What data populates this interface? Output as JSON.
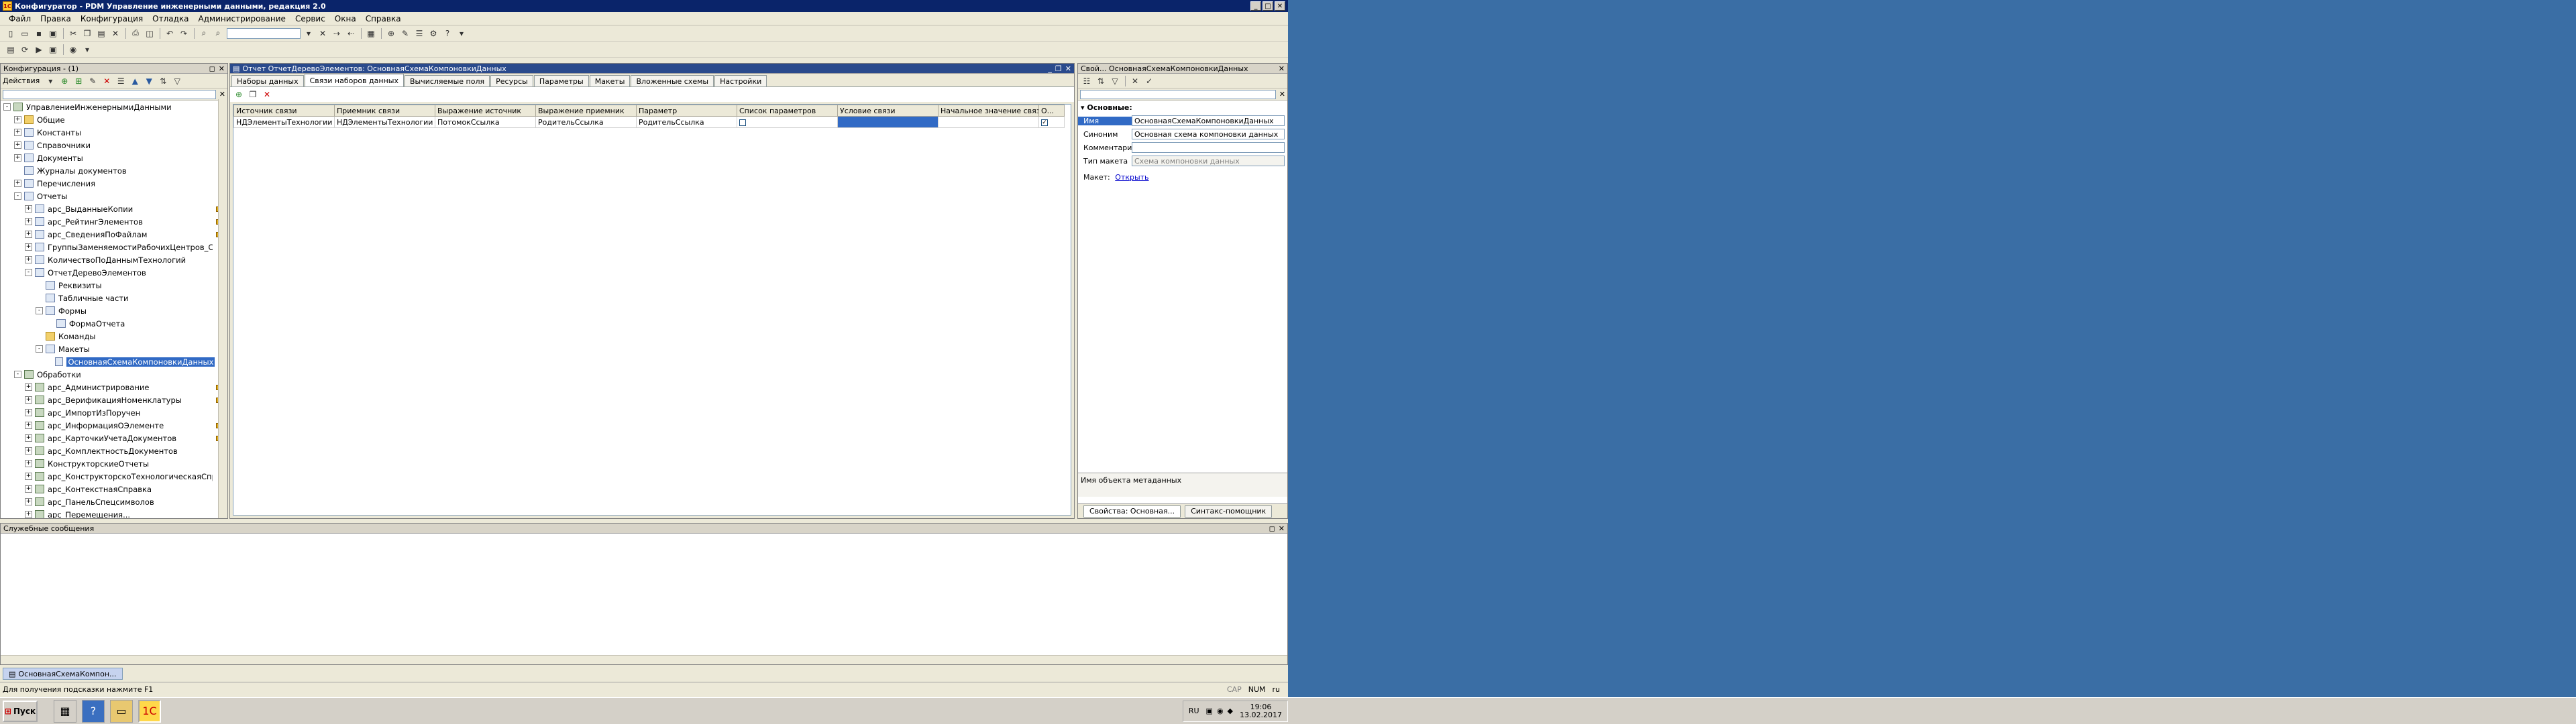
{
  "window": {
    "title": "Конфигуратор - PDM Управление инженерными данными, редакция 2.0"
  },
  "menu": [
    "Файл",
    "Правка",
    "Конфигурация",
    "Отладка",
    "Администрирование",
    "Сервис",
    "Окна",
    "Справка"
  ],
  "config_panel": {
    "title": "Конфигурация - (1)",
    "actions_label": "Действия",
    "tree": [
      {
        "label": "УправлениеИнженернымиДанными",
        "level": 0,
        "exp": "-",
        "icon": "gear",
        "sel": false,
        "marks": 1
      },
      {
        "label": "Общие",
        "level": 1,
        "exp": "+",
        "icon": "folder",
        "sel": false,
        "marks": 0
      },
      {
        "label": "Константы",
        "level": 1,
        "exp": "+",
        "icon": "doc",
        "sel": false,
        "marks": 0
      },
      {
        "label": "Справочники",
        "level": 1,
        "exp": "+",
        "icon": "doc",
        "sel": false,
        "marks": 0
      },
      {
        "label": "Документы",
        "level": 1,
        "exp": "+",
        "icon": "doc",
        "sel": false,
        "marks": 0
      },
      {
        "label": "Журналы документов",
        "level": 1,
        "exp": "",
        "icon": "doc",
        "sel": false,
        "marks": 0
      },
      {
        "label": "Перечисления",
        "level": 1,
        "exp": "+",
        "icon": "doc",
        "sel": false,
        "marks": 0
      },
      {
        "label": "Отчеты",
        "level": 1,
        "exp": "-",
        "icon": "doc",
        "sel": false,
        "marks": 0
      },
      {
        "label": "арс_ВыданныеКопии",
        "level": 2,
        "exp": "+",
        "icon": "doc",
        "sel": false,
        "marks": 2
      },
      {
        "label": "арс_РейтингЭлементов",
        "level": 2,
        "exp": "+",
        "icon": "doc",
        "sel": false,
        "marks": 2
      },
      {
        "label": "арс_СведенияПоФайлам",
        "level": 2,
        "exp": "+",
        "icon": "doc",
        "sel": false,
        "marks": 2
      },
      {
        "label": "ГруппыЗаменяемостиРабочихЦентров_Сп...",
        "level": 2,
        "exp": "+",
        "icon": "doc",
        "sel": false,
        "marks": 0
      },
      {
        "label": "КоличествоПоДаннымТехнологий",
        "level": 2,
        "exp": "+",
        "icon": "doc",
        "sel": false,
        "marks": 0
      },
      {
        "label": "ОтчетДеревоЭлементов",
        "level": 2,
        "exp": "-",
        "icon": "doc",
        "sel": false,
        "marks": 0
      },
      {
        "label": "Реквизиты",
        "level": 3,
        "exp": "",
        "icon": "doc",
        "sel": false,
        "marks": 0
      },
      {
        "label": "Табличные части",
        "level": 3,
        "exp": "",
        "icon": "doc",
        "sel": false,
        "marks": 0
      },
      {
        "label": "Формы",
        "level": 3,
        "exp": "-",
        "icon": "doc",
        "sel": false,
        "marks": 0
      },
      {
        "label": "ФормаОтчета",
        "level": 4,
        "exp": "",
        "icon": "doc",
        "sel": false,
        "marks": 0
      },
      {
        "label": "Команды",
        "level": 3,
        "exp": "",
        "icon": "folder",
        "sel": false,
        "marks": 0
      },
      {
        "label": "Макеты",
        "level": 3,
        "exp": "-",
        "icon": "doc",
        "sel": false,
        "marks": 0
      },
      {
        "label": "ОсновнаяСхемаКомпоновкиДанных",
        "level": 4,
        "exp": "",
        "icon": "doc",
        "sel": true,
        "marks": 0
      },
      {
        "label": "Обработки",
        "level": 1,
        "exp": "-",
        "icon": "gear",
        "sel": false,
        "marks": 0
      },
      {
        "label": "арс_Администрирование",
        "level": 2,
        "exp": "+",
        "icon": "gear",
        "sel": false,
        "marks": 2
      },
      {
        "label": "арс_ВерификацияНоменклатуры",
        "level": 2,
        "exp": "+",
        "icon": "gear",
        "sel": false,
        "marks": 2
      },
      {
        "label": "арс_ИмпортИзПоручен",
        "level": 2,
        "exp": "+",
        "icon": "gear",
        "sel": false,
        "marks": 1
      },
      {
        "label": "арс_ИнформацияОЭлементе",
        "level": 2,
        "exp": "+",
        "icon": "gear",
        "sel": false,
        "marks": 2
      },
      {
        "label": "арс_КарточкиУчетаДокументов",
        "level": 2,
        "exp": "+",
        "icon": "gear",
        "sel": false,
        "marks": 2
      },
      {
        "label": "арс_КомплектностьДокументов",
        "level": 2,
        "exp": "+",
        "icon": "gear",
        "sel": false,
        "marks": 1
      },
      {
        "label": "КонструкторскиеОтчеты",
        "level": 2,
        "exp": "+",
        "icon": "gear",
        "sel": false,
        "marks": 0
      },
      {
        "label": "арс_КонструкторскоТехнологическаяСпра...",
        "level": 2,
        "exp": "+",
        "icon": "gear",
        "sel": false,
        "marks": 0
      },
      {
        "label": "арс_КонтекстнаяСправка",
        "level": 2,
        "exp": "+",
        "icon": "gear",
        "sel": false,
        "marks": 0
      },
      {
        "label": "арс_ПанельСпецсимволов",
        "level": 2,
        "exp": "+",
        "icon": "gear",
        "sel": false,
        "marks": 0
      },
      {
        "label": "арс_Перемещения...",
        "level": 2,
        "exp": "+",
        "icon": "gear",
        "sel": false,
        "marks": 0
      }
    ]
  },
  "editor": {
    "title": "Отчет ОтчетДеревоЭлементов: ОсновнаяСхемаКомпоновкиДанных",
    "tabs": [
      {
        "label": "Наборы данных",
        "active": false
      },
      {
        "label": "Связи наборов данных",
        "active": true
      },
      {
        "label": "Вычисляемые поля",
        "active": false
      },
      {
        "label": "Ресурсы",
        "active": false
      },
      {
        "label": "Параметры",
        "active": false
      },
      {
        "label": "Макеты",
        "active": false
      },
      {
        "label": "Вложенные схемы",
        "active": false
      },
      {
        "label": "Настройки",
        "active": false
      }
    ],
    "columns": [
      "Источник связи",
      "Приемник связи",
      "Выражение источник",
      "Выражение приемник",
      "Параметр",
      "Список параметров",
      "Условие связи",
      "Начальное значение связи",
      "О..."
    ],
    "rows": [
      {
        "source": "НДЭлементыТехнологии",
        "receiver": "НДЭлементыТехнологии",
        "expr_source": "ПотомокСсылка",
        "expr_receiver": "РодительСсылка",
        "param": "РодительСсылка",
        "param_list": false,
        "condition": "",
        "initial": "",
        "o": true
      }
    ]
  },
  "properties": {
    "title": "Свой... ОсновнаяСхемаКомпоновкиДанных",
    "group": "Основные:",
    "fields": [
      {
        "name": "Имя",
        "value": "ОсновнаяСхемаКомпоновкиДанных",
        "sel": true,
        "disabled": false
      },
      {
        "name": "Синоним",
        "value": "Основная схема компоновки данных",
        "sel": false,
        "disabled": false
      },
      {
        "name": "Комментарий",
        "value": "",
        "sel": false,
        "disabled": false
      },
      {
        "name": "Тип макета",
        "value": "Схема компоновки данных",
        "sel": false,
        "disabled": true
      }
    ],
    "maket_label": "Макет:",
    "maket_link": "Открыть",
    "hint": "Имя объекта метаданных",
    "bottom_tabs": [
      "Свойства: Основная...",
      "Синтакс-помощник"
    ]
  },
  "messages": {
    "title": "Служебные сообщения"
  },
  "window_tab": "ОсновнаяСхемаКомпон...",
  "status": {
    "text": "Для получения подсказки нажмите F1",
    "caps": "CAP",
    "num": "NUM",
    "lang": "ru"
  },
  "taskbar": {
    "start": "Пуск",
    "lang": "RU",
    "time": "19:06",
    "date": "13.02.2017"
  }
}
